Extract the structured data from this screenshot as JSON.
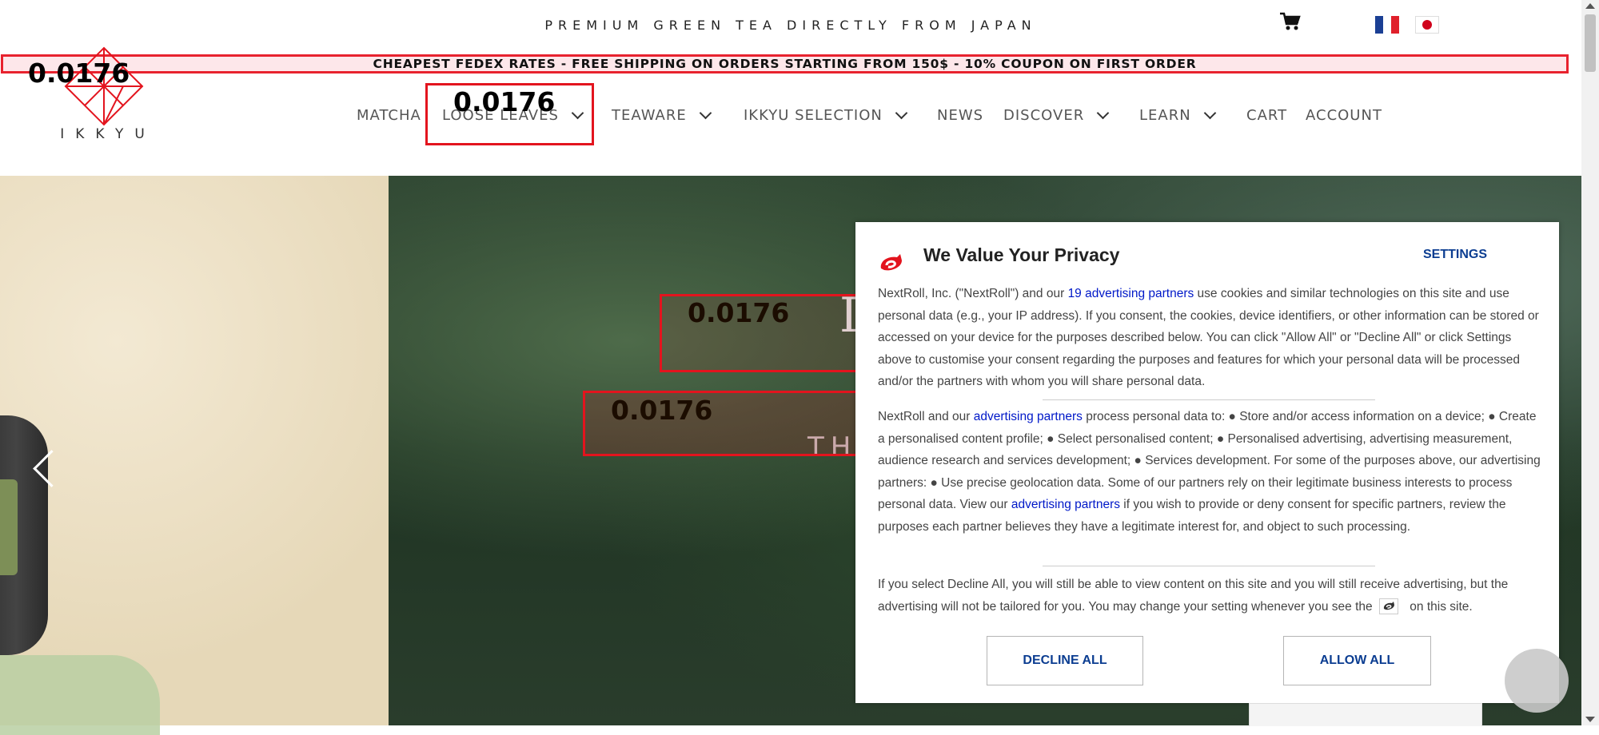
{
  "header": {
    "tagline": "PREMIUM GREEN TEA DIRECTLY FROM JAPAN",
    "cart_icon": "shopping-cart-icon",
    "flags": [
      {
        "name": "french-flag-icon",
        "colors": [
          "#1b3f94",
          "#ffffff",
          "#e0202b"
        ]
      },
      {
        "name": "japanese-flag-icon",
        "colors": [
          "#ffffff",
          "#d0021b"
        ]
      }
    ]
  },
  "promo": {
    "text": "CHEAPEST FEDEX RATES - FREE SHIPPING ON ORDERS STARTING FROM 150$ - 10% COUPON ON FIRST ORDER"
  },
  "logo": {
    "text": "IKKYU",
    "icon": "ikkyu-logo-icon",
    "color": "#e3141e"
  },
  "nav": {
    "items": [
      {
        "label": "MATCHA",
        "has_dropdown": false
      },
      {
        "label": "LOOSE LEAVES",
        "has_dropdown": true
      },
      {
        "label": "TEAWARE",
        "has_dropdown": true
      },
      {
        "label": "IKKYU SELECTION",
        "has_dropdown": true
      },
      {
        "label": "NEWS",
        "has_dropdown": false
      },
      {
        "label": "DISCOVER",
        "has_dropdown": true
      },
      {
        "label": "LEARN",
        "has_dropdown": true
      },
      {
        "label": "CART",
        "has_dropdown": false
      },
      {
        "label": "ACCOUNT",
        "has_dropdown": false
      }
    ]
  },
  "highlights": {
    "logo_value": "0.0176",
    "nav_value": "0.0176",
    "hero_title_value": "0.0176",
    "hero_sub_value": "0.0176",
    "color": "#e3141e"
  },
  "hero": {
    "title_char": "I",
    "subtitle_chars": "TH",
    "prev_icon": "chevron-left-icon"
  },
  "consent": {
    "title": "We Value Your Privacy",
    "settings_label": "SETTINGS",
    "logo_icon": "nextroll-logo-icon",
    "p1_a": "NextRoll, Inc. (\"NextRoll\") and our ",
    "p1_link": "19 advertising partners",
    "p1_b": " use cookies and similar technologies on this site and use personal data (e.g., your IP address). If you consent, the cookies, device identifiers, or other information can be stored or accessed on your device for the purposes described below. You can click \"Allow All\" or \"Decline All\" or click Settings above to customise your consent regarding the purposes and features for which your personal data will be processed and/or the partners with whom you will share personal data.",
    "p2_a": "NextRoll and our ",
    "p2_link1": "advertising partners",
    "p2_b": " process personal data to: ● Store and/or access information on a device; ● Create a personalised content profile; ● Select personalised content; ● Personalised advertising, advertising measurement, audience research and services development; ● Services development. For some of the purposes above, our advertising partners: ● Use precise geolocation data. Some of our partners rely on their legitimate business interests to process personal data. View our ",
    "p2_link2": "advertising partners",
    "p2_c": " if you wish to provide or deny consent for specific partners, review the purposes each partner believes they have a legitimate interest for, and object to such processing.",
    "p3_a": "If you select Decline All, you will still be able to view content on this site and you will still receive advertising, but the advertising will not be tailored for you. You may change your setting whenever you see the ",
    "p3_b": " on this site.",
    "decline_label": "DECLINE ALL",
    "allow_label": "ALLOW ALL",
    "link_color": "#0018c8",
    "button_color": "#0b3d91"
  }
}
